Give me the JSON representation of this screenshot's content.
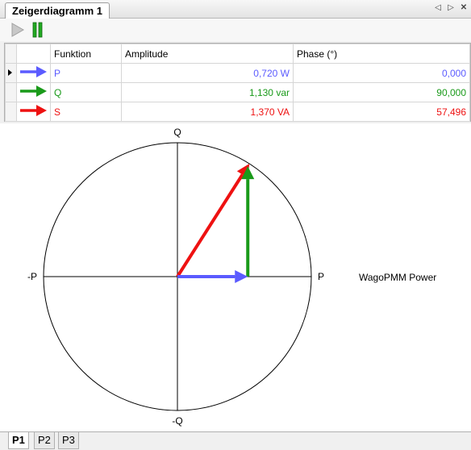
{
  "window": {
    "tab_title": "Zeigerdiagramm 1",
    "controls": [
      "◁",
      "▷",
      "✕"
    ]
  },
  "toolbar": {
    "play_icon": "play-icon",
    "pause_icon": "pause-icon"
  },
  "table": {
    "headers": [
      "",
      "Funktion",
      "Amplitude",
      "Phase (°)"
    ],
    "rows": [
      {
        "selected": true,
        "color": "#5b5bff",
        "funktion": "P",
        "amplitude": "0,720 W",
        "phase": "0,000"
      },
      {
        "selected": false,
        "color": "#1a9a1a",
        "funktion": "Q",
        "amplitude": "1,130 var",
        "phase": "90,000"
      },
      {
        "selected": false,
        "color": "#ee1111",
        "funktion": "S",
        "amplitude": "1,370 VA",
        "phase": "57,496"
      }
    ]
  },
  "diagram": {
    "label_top": "Q",
    "label_bottom": "-Q",
    "label_left": "-P",
    "label_right": "P",
    "legend": "WagoPMM Power",
    "scale_max": 1.37
  },
  "bottom_tabs": [
    "P1",
    "P2",
    "P3"
  ],
  "active_bottom_tab": 0
}
